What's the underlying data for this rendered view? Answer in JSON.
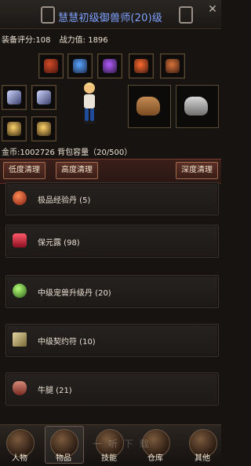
{
  "header": {
    "title": "慧慧初级御兽师(20)级",
    "close_glyph": "✕"
  },
  "stats": {
    "equip_score": "装备评分:108",
    "combat_power": "战力值: 1896"
  },
  "inventory": {
    "gold_text": "金币:1002726",
    "capacity_text": "背包容量（20/500）"
  },
  "buttons": {
    "low_clean": "低度清理",
    "high_clean": "高度清理",
    "deep_clean": "深度清理"
  },
  "items": [
    {
      "label": "极品经验丹 (5)",
      "icon": "pill-icon"
    },
    {
      "label": "保元露 (98)",
      "icon": "potion-icon"
    },
    {
      "label": "中级宠兽升级丹 (20)",
      "icon": "orb-icon"
    },
    {
      "label": "中级契约符 (10)",
      "icon": "scroll-icon"
    },
    {
      "label": "牛腿 (21)",
      "icon": "meat-icon"
    }
  ],
  "nav": {
    "tabs": [
      {
        "label": "人物"
      },
      {
        "label": "物品"
      },
      {
        "label": "技能"
      },
      {
        "label": "仓库"
      },
      {
        "label": "其他"
      }
    ]
  },
  "watermark": "一 听 下 载",
  "colors": {
    "title_blue": "#7fa2ff",
    "panel_bg": "#171310",
    "button_bg": "#4a261f"
  }
}
